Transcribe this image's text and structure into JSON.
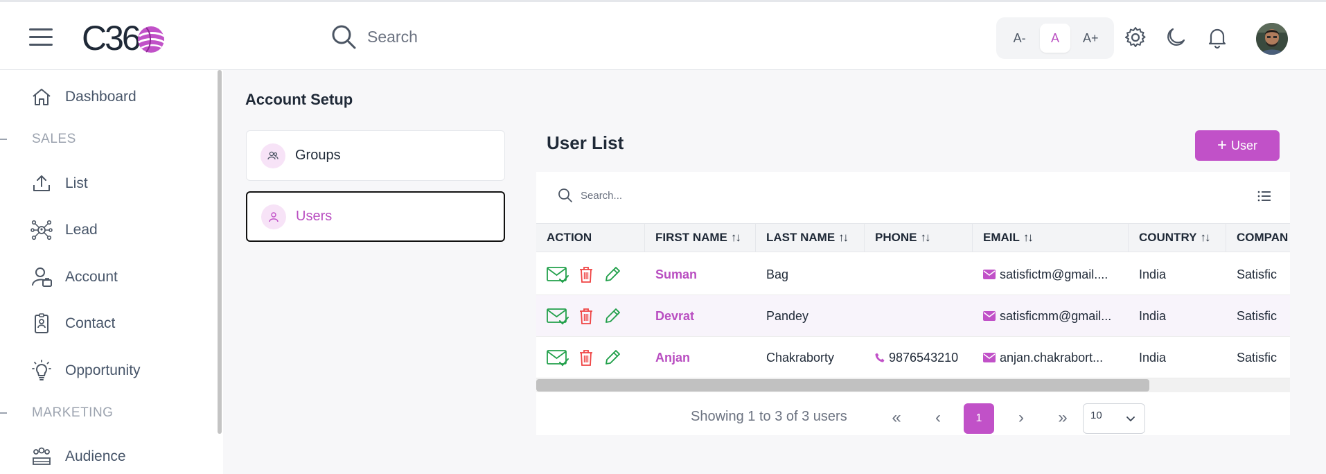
{
  "header": {
    "logo_text": "C36",
    "search_placeholder": "Search",
    "font_sizes": [
      "A-",
      "A",
      "A+"
    ],
    "active_font_size": "A",
    "accent_color": "#c151c8"
  },
  "sidebar": {
    "items": [
      {
        "label": "Dashboard",
        "icon": "home-icon"
      },
      {
        "section": "SALES"
      },
      {
        "label": "List",
        "icon": "upload-icon"
      },
      {
        "label": "Lead",
        "icon": "lead-network-icon"
      },
      {
        "label": "Account",
        "icon": "account-user-icon"
      },
      {
        "label": "Contact",
        "icon": "contact-badge-icon"
      },
      {
        "label": "Opportunity",
        "icon": "lightbulb-icon"
      },
      {
        "section": "MARKETING"
      },
      {
        "label": "Audience",
        "icon": "audience-group-icon"
      }
    ]
  },
  "page": {
    "title": "Account Setup",
    "setup_items": [
      {
        "label": "Groups",
        "active": false
      },
      {
        "label": "Users",
        "active": true
      }
    ]
  },
  "user_list": {
    "title": "User List",
    "add_button": "User",
    "search_placeholder": "Search...",
    "columns": [
      "ACTION",
      "FIRST NAME",
      "LAST NAME",
      "PHONE",
      "EMAIL",
      "COUNTRY",
      "COMPAN"
    ],
    "rows": [
      {
        "first": "Suman",
        "last": "Bag",
        "phone": "",
        "email": "satisfictm@gmail....",
        "country": "India",
        "company": "Satisfic"
      },
      {
        "first": "Devrat",
        "last": "Pandey",
        "phone": "",
        "email": "satisficmm@gmail...",
        "country": "India",
        "company": "Satisfic"
      },
      {
        "first": "Anjan",
        "last": "Chakraborty",
        "phone": "9876543210",
        "email": "anjan.chakrabort...",
        "country": "India",
        "company": "Satisfic"
      }
    ],
    "pagination": {
      "summary": "Showing 1 to 3 of 3 users",
      "current_page": "1",
      "page_size": "10"
    }
  }
}
